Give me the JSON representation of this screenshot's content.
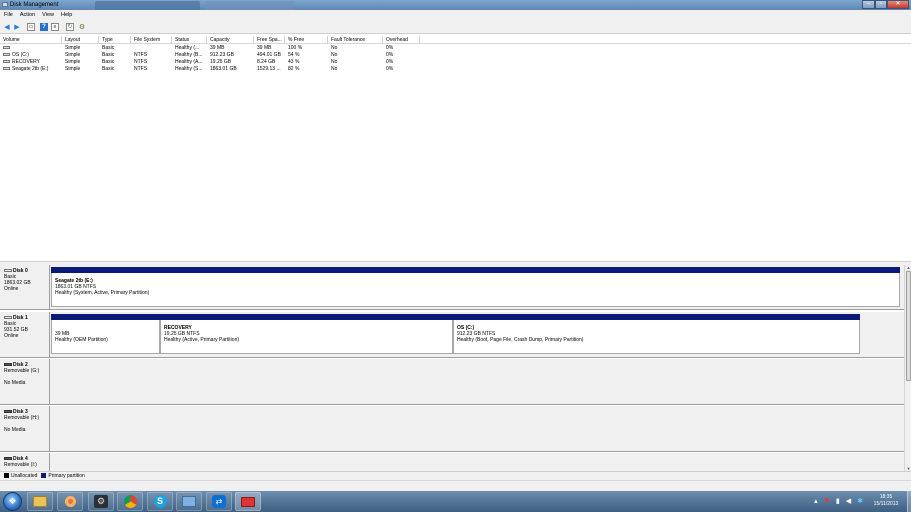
{
  "window": {
    "title": "Disk Management"
  },
  "menu": {
    "items": [
      "File",
      "Action",
      "View",
      "Help"
    ]
  },
  "toolbar": {
    "icons": [
      "back-arrow-icon",
      "forward-arrow-icon",
      "properties-icon",
      "help-icon",
      "list-view-icon",
      "rescan-icon",
      "settings-icon"
    ]
  },
  "volumes": {
    "columns": [
      "Volume",
      "Layout",
      "Type",
      "File System",
      "Status",
      "Capacity",
      "Free Spa...",
      "% Free",
      "Fault Tolerance",
      "Overhead"
    ],
    "rows": [
      [
        "",
        "Simple",
        "Basic",
        "",
        "Healthy (...",
        "39 MB",
        "39 MB",
        "100 %",
        "No",
        "0%"
      ],
      [
        "OS (C:)",
        "Simple",
        "Basic",
        "NTFS",
        "Healthy (B...",
        "912.23 GB",
        "494.01 GB",
        "54 %",
        "No",
        "0%"
      ],
      [
        "RECOVERY",
        "Simple",
        "Basic",
        "NTFS",
        "Healthy (A...",
        "19.25 GB",
        "8.24 GB",
        "43 %",
        "No",
        "0%"
      ],
      [
        "Seagate 2tb (E:)",
        "Simple",
        "Basic",
        "NTFS",
        "Healthy (S...",
        "1863.01 GB",
        "1529.13 ...",
        "82 %",
        "No",
        "0%"
      ]
    ]
  },
  "disks": [
    {
      "name": "Disk 0",
      "line1": "Basic",
      "line2": "1863.02 GB",
      "line3": "Online",
      "partitions": [
        {
          "title": "Seagate 2tb  (E:)",
          "size": "1863.01 GB NTFS",
          "status": "Healthy (System, Active, Primary Partition)"
        }
      ]
    },
    {
      "name": "Disk 1",
      "line1": "Basic",
      "line2": "931.52 GB",
      "line3": "Online",
      "partitions": [
        {
          "title": "",
          "size": "39 MB",
          "status": "Healthy (OEM Partition)"
        },
        {
          "title": "RECOVERY",
          "size": "19.25 GB NTFS",
          "status": "Healthy (Active, Primary Partition)"
        },
        {
          "title": "OS  (C:)",
          "size": "912.23 GB NTFS",
          "status": "Healthy (Boot, Page File, Crash Dump, Primary Partition)"
        }
      ]
    },
    {
      "name": "Disk 2",
      "line1": "Removable (G:)",
      "line2": "",
      "line3": "No Media",
      "partitions": []
    },
    {
      "name": "Disk 3",
      "line1": "Removable (H:)",
      "line2": "",
      "line3": "No Media",
      "partitions": []
    },
    {
      "name": "Disk 4",
      "line1": "Removable (I:)",
      "line2": "",
      "line3": "",
      "partitions": []
    }
  ],
  "legend": {
    "unallocated": "Unallocated",
    "primary": "Primary partition",
    "unallocated_color": "#000000",
    "primary_color": "#0a1a78"
  },
  "taskbar": {
    "apps": [
      "explorer-icon",
      "media-icon",
      "steam-icon",
      "chrome-icon",
      "skype-icon",
      "network-icon",
      "teamviewer-icon",
      "disk-management-icon"
    ]
  },
  "clock": {
    "time": "18:35",
    "date": "15/11/2013"
  }
}
